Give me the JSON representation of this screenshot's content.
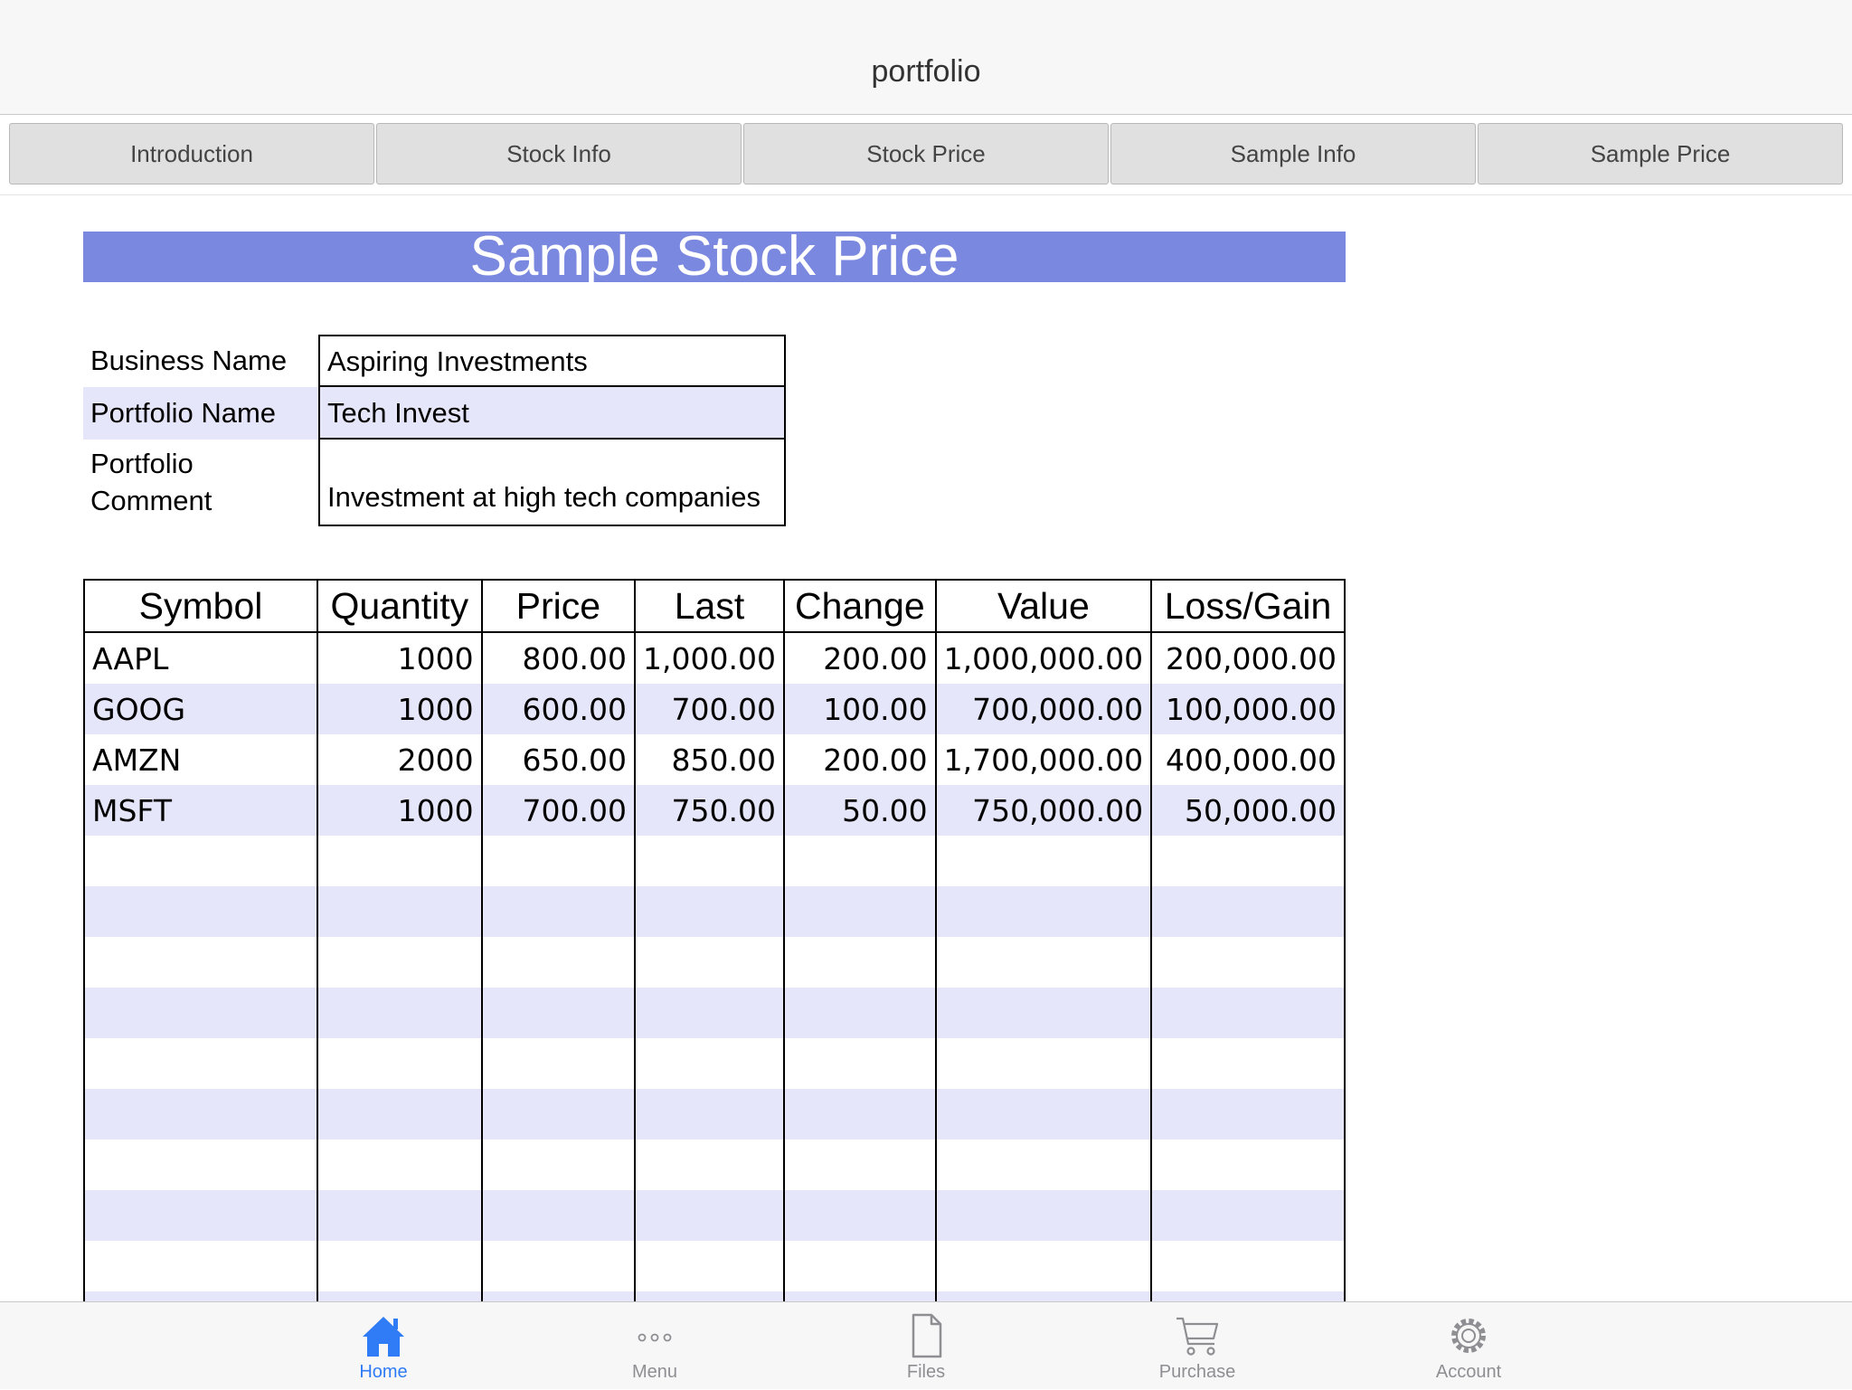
{
  "navbar": {
    "title": "portfolio"
  },
  "tabs": [
    {
      "label": "Introduction"
    },
    {
      "label": "Stock Info"
    },
    {
      "label": "Stock Price"
    },
    {
      "label": "Sample Info"
    },
    {
      "label": "Sample Price"
    }
  ],
  "sheet": {
    "title": "Sample Stock Price",
    "title_bar_color": "#7b88df",
    "alt_row_color": "#e6e6fa",
    "info": {
      "business_name_label": "Business Name",
      "business_name_value": "Aspiring Investments",
      "portfolio_name_label": "Portfolio Name",
      "portfolio_name_value": "Tech Invest",
      "portfolio_comment_label_line1": "Portfolio",
      "portfolio_comment_label_line2": "Comment",
      "portfolio_comment_value": "Investment at high tech companies"
    },
    "grid": {
      "headers": [
        "Symbol",
        "Quantity",
        "Price",
        "Last",
        "Change",
        "Value",
        "Loss/Gain"
      ],
      "rows": [
        [
          "AAPL",
          "1000",
          "800.00",
          "1,000.00",
          "200.00",
          "1,000,000.00",
          "200,000.00"
        ],
        [
          "GOOG",
          "1000",
          "600.00",
          "700.00",
          "100.00",
          "700,000.00",
          "100,000.00"
        ],
        [
          "AMZN",
          "2000",
          "650.00",
          "850.00",
          "200.00",
          "1,700,000.00",
          "400,000.00"
        ],
        [
          "MSFT",
          "1000",
          "700.00",
          "750.00",
          "50.00",
          "750,000.00",
          "50,000.00"
        ]
      ]
    }
  },
  "tabbar": {
    "items": [
      {
        "label": "Home",
        "icon": "home-icon",
        "active": true
      },
      {
        "label": "Menu",
        "icon": "more-icon",
        "active": false
      },
      {
        "label": "Files",
        "icon": "file-icon",
        "active": false
      },
      {
        "label": "Purchase",
        "icon": "cart-icon",
        "active": false
      },
      {
        "label": "Account",
        "icon": "gear-icon",
        "active": false
      }
    ],
    "active_color": "#2f7cf6",
    "inactive_color": "#8e8e93"
  }
}
